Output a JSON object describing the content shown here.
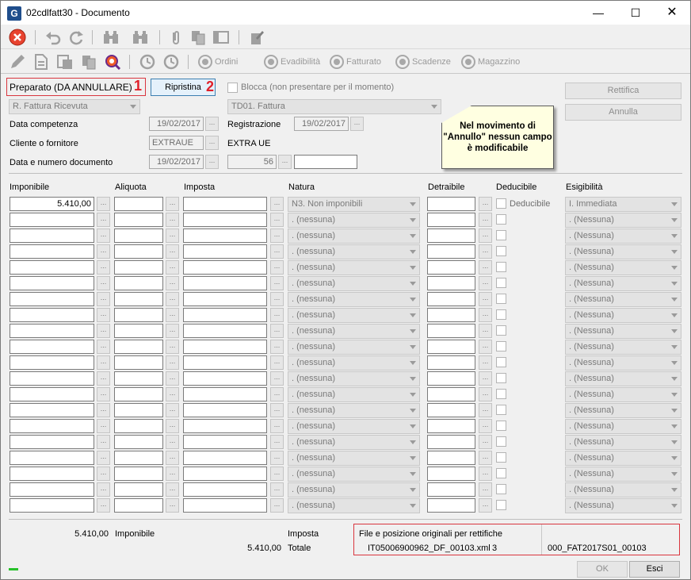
{
  "window": {
    "title": "02cdlfatt30 - Documento",
    "app_icon": "G"
  },
  "toolbar2": {
    "buttons": [
      "Ordini",
      "Evadibilità",
      "Fatturato",
      "Scadenze",
      "Magazzino"
    ]
  },
  "header": {
    "status_label": "Preparato (DA ANNULLARE)",
    "marker1": "1",
    "ripristina": "Ripristina",
    "marker2": "2",
    "blocca_label": "Blocca (non presentare per il momento)",
    "doc_type": "R. Fattura Ricevuta",
    "td_type": "TD01. Fattura",
    "data_competenza_label": "Data competenza",
    "data_competenza": "19/02/2017",
    "registrazione_label": "Registrazione",
    "registrazione": "19/02/2017",
    "cliente_label": "Cliente o fornitore",
    "cliente_code": "EXTRAUE",
    "cliente_name": "EXTRA UE",
    "data_numero_label": "Data e numero documento",
    "data_doc": "19/02/2017",
    "numero_doc": "56",
    "numero_suffix": "",
    "rettifica": "Rettifica",
    "annulla": "Annulla",
    "callout": "Nel movimento di \"Annullo\" nessun campo è modificabile"
  },
  "table": {
    "headers": {
      "imponibile": "Imponibile",
      "aliquota": "Aliquota",
      "imposta": "Imposta",
      "natura": "Natura",
      "detraibile": "Detraibile",
      "deducibile": "Deducibile",
      "esigibilita": "Esigibilità"
    },
    "rows": [
      {
        "imponibile": "5.410,00",
        "aliquota": "",
        "imposta": "",
        "natura": "N3. Non imponibili",
        "detraibile": "",
        "deducibile_label": "Deducibile",
        "esigibilita": "I. Immediata"
      },
      {
        "imponibile": "",
        "aliquota": "",
        "imposta": "",
        "natura": ". (nessuna)",
        "detraibile": "",
        "deducibile_label": "",
        "esigibilita": ". (Nessuna)"
      },
      {
        "imponibile": "",
        "aliquota": "",
        "imposta": "",
        "natura": ". (nessuna)",
        "detraibile": "",
        "deducibile_label": "",
        "esigibilita": ". (Nessuna)"
      },
      {
        "imponibile": "",
        "aliquota": "",
        "imposta": "",
        "natura": ". (nessuna)",
        "detraibile": "",
        "deducibile_label": "",
        "esigibilita": ". (Nessuna)"
      },
      {
        "imponibile": "",
        "aliquota": "",
        "imposta": "",
        "natura": ". (nessuna)",
        "detraibile": "",
        "deducibile_label": "",
        "esigibilita": ". (Nessuna)"
      },
      {
        "imponibile": "",
        "aliquota": "",
        "imposta": "",
        "natura": ". (nessuna)",
        "detraibile": "",
        "deducibile_label": "",
        "esigibilita": ". (Nessuna)"
      },
      {
        "imponibile": "",
        "aliquota": "",
        "imposta": "",
        "natura": ". (nessuna)",
        "detraibile": "",
        "deducibile_label": "",
        "esigibilita": ". (Nessuna)"
      },
      {
        "imponibile": "",
        "aliquota": "",
        "imposta": "",
        "natura": ". (nessuna)",
        "detraibile": "",
        "deducibile_label": "",
        "esigibilita": ". (Nessuna)"
      },
      {
        "imponibile": "",
        "aliquota": "",
        "imposta": "",
        "natura": ". (nessuna)",
        "detraibile": "",
        "deducibile_label": "",
        "esigibilita": ". (Nessuna)"
      },
      {
        "imponibile": "",
        "aliquota": "",
        "imposta": "",
        "natura": ". (nessuna)",
        "detraibile": "",
        "deducibile_label": "",
        "esigibilita": ". (Nessuna)"
      },
      {
        "imponibile": "",
        "aliquota": "",
        "imposta": "",
        "natura": ". (nessuna)",
        "detraibile": "",
        "deducibile_label": "",
        "esigibilita": ". (Nessuna)"
      },
      {
        "imponibile": "",
        "aliquota": "",
        "imposta": "",
        "natura": ". (nessuna)",
        "detraibile": "",
        "deducibile_label": "",
        "esigibilita": ". (Nessuna)"
      },
      {
        "imponibile": "",
        "aliquota": "",
        "imposta": "",
        "natura": ". (nessuna)",
        "detraibile": "",
        "deducibile_label": "",
        "esigibilita": ". (Nessuna)"
      },
      {
        "imponibile": "",
        "aliquota": "",
        "imposta": "",
        "natura": ". (nessuna)",
        "detraibile": "",
        "deducibile_label": "",
        "esigibilita": ". (Nessuna)"
      },
      {
        "imponibile": "",
        "aliquota": "",
        "imposta": "",
        "natura": ". (nessuna)",
        "detraibile": "",
        "deducibile_label": "",
        "esigibilita": ". (Nessuna)"
      },
      {
        "imponibile": "",
        "aliquota": "",
        "imposta": "",
        "natura": ". (nessuna)",
        "detraibile": "",
        "deducibile_label": "",
        "esigibilita": ". (Nessuna)"
      },
      {
        "imponibile": "",
        "aliquota": "",
        "imposta": "",
        "natura": ". (nessuna)",
        "detraibile": "",
        "deducibile_label": "",
        "esigibilita": ". (Nessuna)"
      },
      {
        "imponibile": "",
        "aliquota": "",
        "imposta": "",
        "natura": ". (nessuna)",
        "detraibile": "",
        "deducibile_label": "",
        "esigibilita": ". (Nessuna)"
      },
      {
        "imponibile": "",
        "aliquota": "",
        "imposta": "",
        "natura": ". (nessuna)",
        "detraibile": "",
        "deducibile_label": "",
        "esigibilita": ". (Nessuna)"
      },
      {
        "imponibile": "",
        "aliquota": "",
        "imposta": "",
        "natura": ". (nessuna)",
        "detraibile": "",
        "deducibile_label": "",
        "esigibilita": ". (Nessuna)"
      }
    ]
  },
  "totals": {
    "imponibile_value": "5.410,00",
    "imponibile_label": "Imponibile",
    "imposta_label": "Imposta",
    "totale_value": "5.410,00",
    "totale_label": "Totale",
    "file_title": "File e posizione originali per rettifiche",
    "file_name": "IT05006900962_DF_00103.xml",
    "file_pos": "3",
    "file_ref": "000_FAT2017S01_00103"
  },
  "footer": {
    "ok": "OK",
    "esci": "Esci"
  },
  "colors": {
    "red_marker": "#e0202a",
    "callout_bg": "#ffffe1",
    "status_green": "#27c12a"
  }
}
